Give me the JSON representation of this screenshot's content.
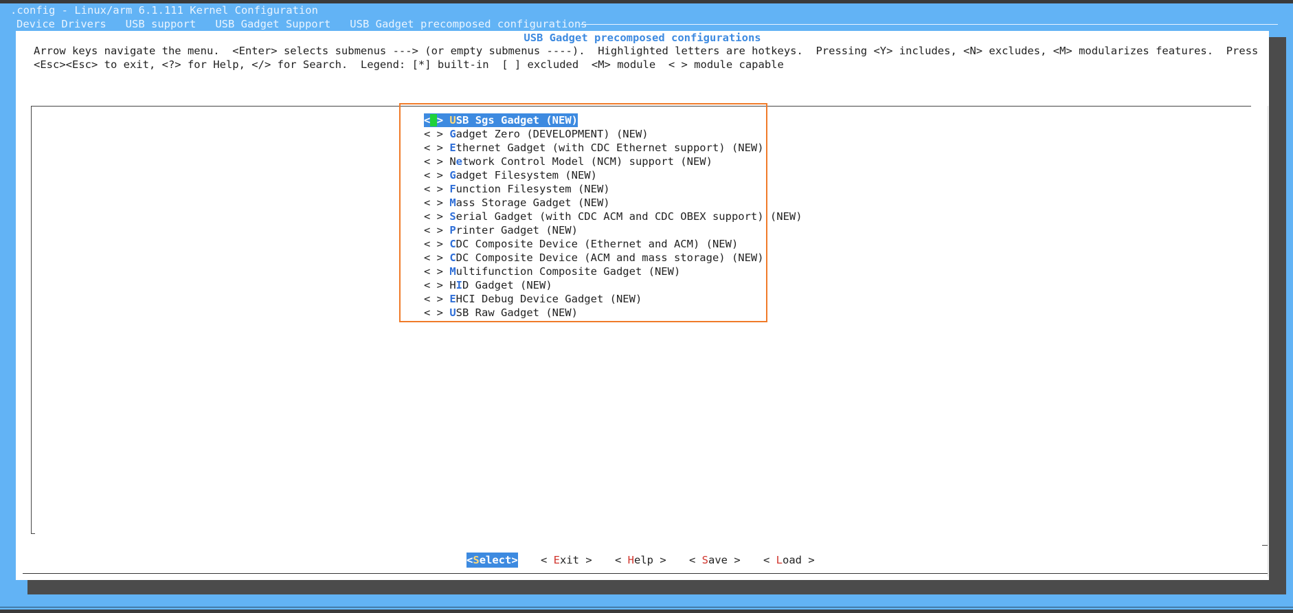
{
  "window": {
    "title": ".config - Linux/arm 6.1.111 Kernel Configuration",
    "breadcrumbs": [
      "Device Drivers",
      "USB support",
      "USB Gadget Support",
      "USB Gadget precomposed configurations"
    ]
  },
  "dialog": {
    "title": "USB Gadget precomposed configurations",
    "help_line_1": "Arrow keys navigate the menu.  <Enter> selects submenus ---> (or empty submenus ----).  Highlighted letters are hotkeys.  Pressing <Y> includes, <N> excludes, <M> modularizes features.  Press",
    "help_line_2": "<Esc><Esc> to exit, <?> for Help, </> for Search.  Legend: [*] built-in  [ ] excluded  <M> module  < > module capable"
  },
  "menu": {
    "prefix": "< > ",
    "items": [
      {
        "hk": "U",
        "rest": "SB Sgs Gadget (NEW)",
        "selected": true
      },
      {
        "hk": "G",
        "rest": "adget Zero (DEVELOPMENT) (NEW)"
      },
      {
        "hk": "E",
        "rest": "thernet Gadget (with CDC Ethernet support) (NEW)"
      },
      {
        "lead": "N",
        "hk": "e",
        "rest": "twork Control Model (NCM) support (NEW)"
      },
      {
        "hk": "G",
        "rest": "adget Filesystem (NEW)"
      },
      {
        "hk": "F",
        "rest": "unction Filesystem (NEW)"
      },
      {
        "hk": "M",
        "rest": "ass Storage Gadget (NEW)"
      },
      {
        "hk": "S",
        "rest": "erial Gadget (with CDC ACM and CDC OBEX support) (NEW)"
      },
      {
        "hk": "P",
        "rest": "rinter Gadget (NEW)"
      },
      {
        "hk": "C",
        "rest": "DC Composite Device (Ethernet and ACM) (NEW)"
      },
      {
        "hk": "C",
        "rest": "DC Composite Device (ACM and mass storage) (NEW)"
      },
      {
        "hk": "M",
        "rest": "ultifunction Composite Gadget (NEW)"
      },
      {
        "lead": "H",
        "hk": "I",
        "rest": "D Gadget (NEW)"
      },
      {
        "hk": "E",
        "rest": "HCI Debug Device Gadget (NEW)"
      },
      {
        "hk": "U",
        "rest": "SB Raw Gadget (NEW)"
      }
    ]
  },
  "buttons": {
    "select": {
      "open": "<",
      "hk": "S",
      "rest": "elect",
      "close": ">"
    },
    "exit": {
      "open": "< ",
      "hk": "E",
      "rest": "xit",
      "close": " >"
    },
    "help": {
      "open": "< ",
      "hk": "H",
      "rest": "elp",
      "close": " >"
    },
    "save": {
      "open": "< ",
      "hk": "S",
      "rest": "ave",
      "close": " >"
    },
    "load": {
      "open": "< ",
      "hk": "L",
      "rest": "oad",
      "close": " >"
    }
  },
  "colors": {
    "background": "#62b3f5",
    "accent": "#3d8ae0",
    "hotkey_menu": "#2f6fd8",
    "hotkey_button": "#d0342c",
    "cursor": "#1fd13a",
    "annotation_box": "#f07a28"
  }
}
